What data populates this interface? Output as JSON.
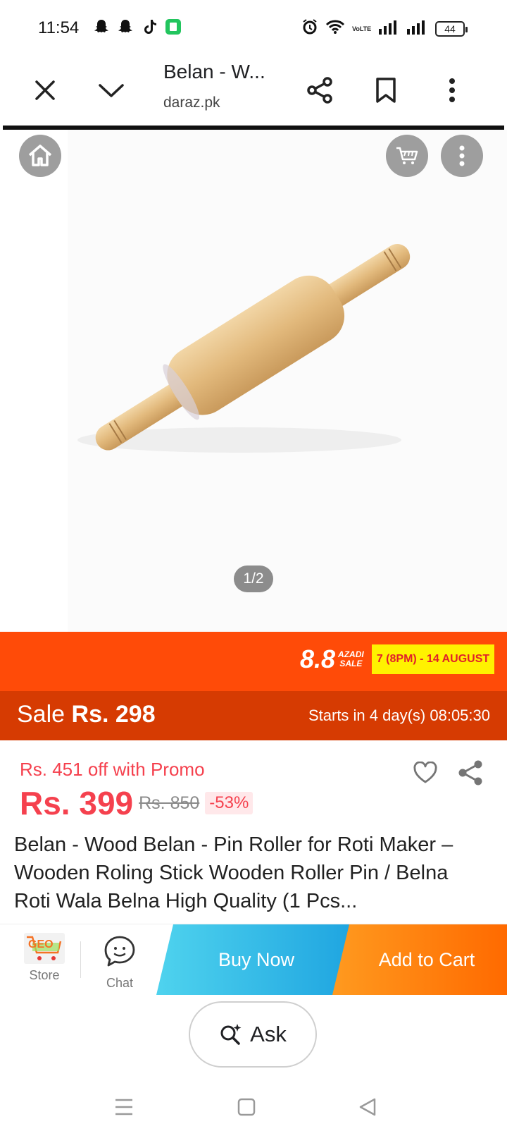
{
  "status_bar": {
    "time": "11:54",
    "network_label": "VoLTE",
    "battery": "44"
  },
  "browser": {
    "title": "Belan - W...",
    "domain": "daraz.pk"
  },
  "gallery": {
    "pager": "1/2"
  },
  "campaign": {
    "number": "8.8",
    "tag_line1": "AZADI",
    "tag_line2": "SALE",
    "date_range": "7 (8PM) - 14 AUGUST"
  },
  "sale": {
    "label_prefix": "Sale",
    "price": "Rs. 298",
    "countdown": "Starts in 4 day(s) 08:05:30"
  },
  "pricing": {
    "promo": "Rs. 451 off with Promo",
    "current": "Rs. 399",
    "original": "Rs. 850",
    "discount": "-53%"
  },
  "product": {
    "title": "Belan - Wood Belan - Pin Roller for Roti Maker – Wooden Roling Stick Wooden Roller Pin / Belna Roti Wala Belna High Quality (1 Pcs..."
  },
  "actions": {
    "store_label": "Store",
    "store_logo_text": "GEO",
    "chat_label": "Chat",
    "buy_now": "Buy Now",
    "add_to_cart": "Add to Cart"
  },
  "ask": {
    "label": "Ask"
  },
  "colors": {
    "accent_red": "#f5414e",
    "campaign_orange": "#ff4b08",
    "sale_bar": "#d63b02",
    "buy_now_blue": "#1ea4e0",
    "add_cart_orange": "#ff6a00"
  }
}
